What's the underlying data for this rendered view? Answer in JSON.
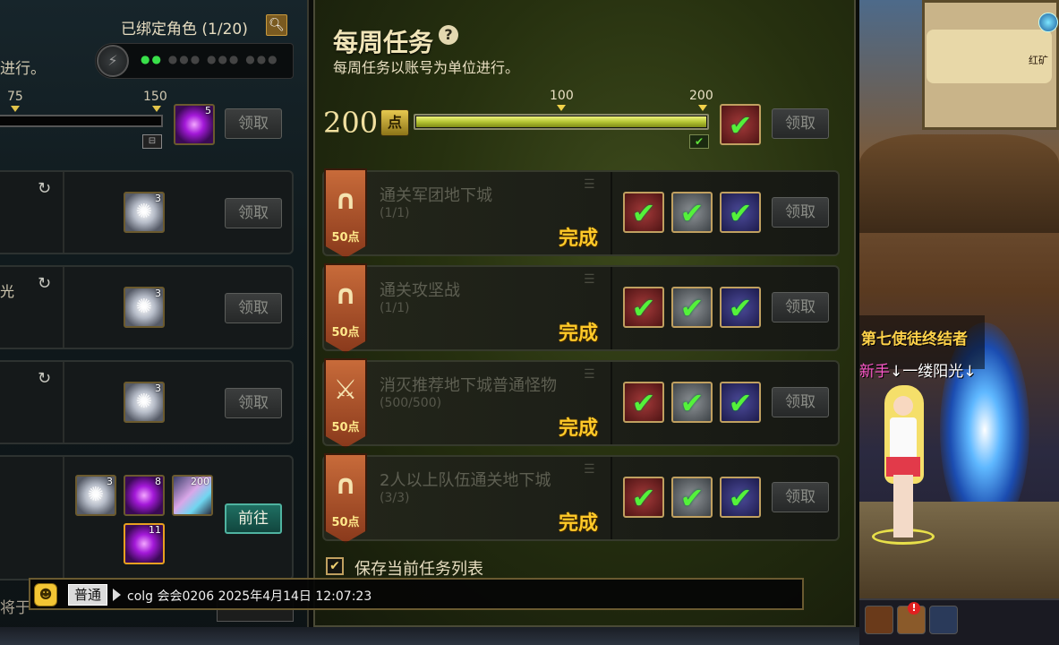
{
  "left_panel": {
    "bound_characters": "已绑定角色 (1/20)",
    "search_icon": "magnifier-icon",
    "description_fragment": "进行。",
    "progress_ticks": [
      "75",
      "150"
    ],
    "progress_fraction": 0.0,
    "main_reward_count": "5",
    "claim_label": "领取",
    "rows": [
      {
        "reward_count": "3",
        "claim_label": "领取"
      },
      {
        "reward_count": "3",
        "claim_label": "领取"
      },
      {
        "reward_count": "3",
        "claim_label": "领取"
      }
    ],
    "bottom_row": {
      "rewards": [
        {
          "kind": "silver",
          "count": "3"
        },
        {
          "kind": "purple",
          "count": "8"
        },
        {
          "kind": "crystal",
          "count": "200"
        },
        {
          "kind": "purple",
          "count": "11"
        }
      ],
      "go_label": "前往"
    },
    "row2_fragment": "光"
  },
  "weekly": {
    "title": "每周任务",
    "subtitle": "每周任务以账号为单位进行。",
    "points": "200",
    "points_unit": "点",
    "ticks": [
      "100",
      "200"
    ],
    "progress_fraction": 1.0,
    "claim_label": "领取",
    "tasks": [
      {
        "name": "通关军团地下城",
        "progress": "(1/1)",
        "points": "50点",
        "status": "完成",
        "icon": "arch-icon",
        "claim_label": "领取"
      },
      {
        "name": "通关攻坚战",
        "progress": "(1/1)",
        "points": "50点",
        "status": "完成",
        "icon": "arch-icon",
        "claim_label": "领取"
      },
      {
        "name": "消灭推荐地下城普通怪物",
        "progress": "(500/500)",
        "points": "50点",
        "status": "完成",
        "icon": "sword-icon",
        "claim_label": "领取"
      },
      {
        "name": "2人以上队伍通关地下城",
        "progress": "(3/3)",
        "points": "50点",
        "status": "完成",
        "icon": "arch-icon",
        "claim_label": "领取"
      }
    ],
    "save_list_label": "保存当前任务列表"
  },
  "chat": {
    "channel": "普通",
    "message": "colg 会会0206 2025年4月14日 12:07:23",
    "under_left": "将于",
    "under_center": ""
  },
  "game_view": {
    "town_label": "红矿",
    "guild_title": "第七使徒终结者",
    "player_prefix": "新手",
    "player_name": "↓一缕阳光↓"
  },
  "colors": {
    "accent_gold": "#f1e5b8",
    "complete_yellow": "#ffc928",
    "check_green": "#54f23a",
    "go_button": "#1f6f62"
  }
}
